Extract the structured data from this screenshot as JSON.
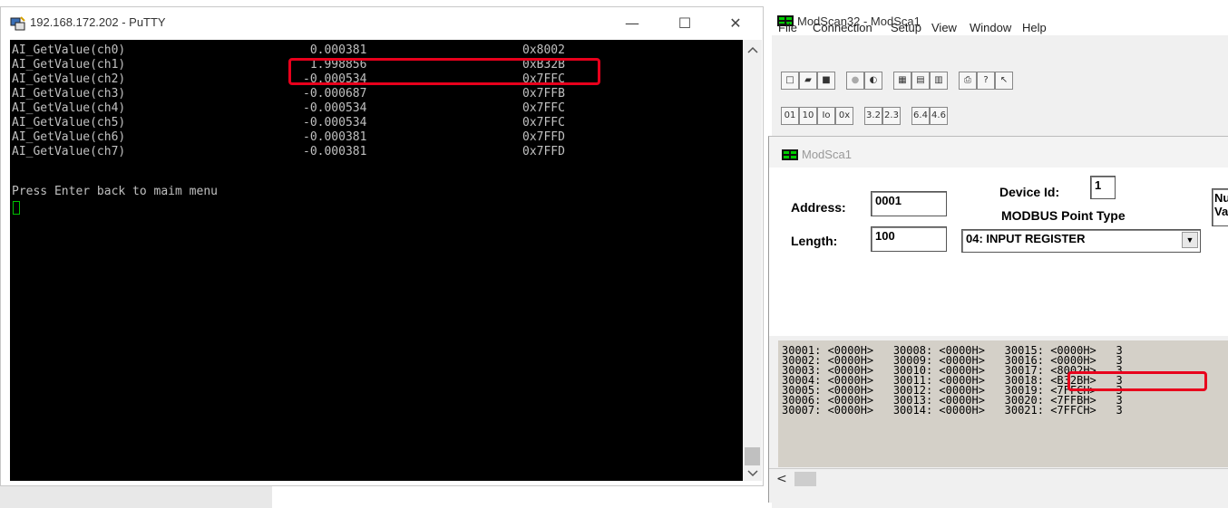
{
  "putty": {
    "title": "192.168.172.202 - PuTTY",
    "controls": {
      "minimize": "—",
      "maximize": "☐",
      "close": "✕"
    },
    "rows": [
      {
        "name": "AI_GetValue(ch0)",
        "value": " 0.000381",
        "hex": "0x8002"
      },
      {
        "name": "AI_GetValue(ch1)",
        "value": " 1.998856",
        "hex": "0xB32B"
      },
      {
        "name": "AI_GetValue(ch2)",
        "value": "-0.000534",
        "hex": "0x7FFC"
      },
      {
        "name": "AI_GetValue(ch3)",
        "value": "-0.000687",
        "hex": "0x7FFB"
      },
      {
        "name": "AI_GetValue(ch4)",
        "value": "-0.000534",
        "hex": "0x7FFC"
      },
      {
        "name": "AI_GetValue(ch5)",
        "value": "-0.000534",
        "hex": "0x7FFC"
      },
      {
        "name": "AI_GetValue(ch6)",
        "value": "-0.000381",
        "hex": "0x7FFD"
      },
      {
        "name": "AI_GetValue(ch7)",
        "value": "-0.000381",
        "hex": "0x7FFD"
      }
    ],
    "prompt": "Press Enter back to maim menu"
  },
  "modscan": {
    "title": "ModScan32 - ModSca1",
    "menu": [
      "File",
      "Connection",
      "Setup",
      "View",
      "Window",
      "Help"
    ],
    "child_title": "ModSca1",
    "device_id_label": "Device Id:",
    "device_id": "1",
    "address_label": "Address:",
    "address": "0001",
    "point_type_label": "MODBUS Point Type",
    "length_label": "Length:",
    "length": "100",
    "point_type": "04: INPUT REGISTER",
    "clipped_labels": [
      "Nu",
      "Va"
    ],
    "registers": [
      "30001: <0000H>   30008: <0000H>   30015: <0000H>   3",
      "30002: <0000H>   30009: <0000H>   30016: <0000H>   3",
      "30003: <0000H>   30010: <0000H>   30017: <8002H>   3",
      "30004: <0000H>   30011: <0000H>   30018: <B32BH>   3",
      "30005: <0000H>   30012: <0000H>   30019: <7FFCH>   3",
      "30006: <0000H>   30013: <0000H>   30020: <7FFBH>   3",
      "30007: <0000H>   30014: <0000H>   30021: <7FFCH>   3"
    ],
    "scroll_left": "<"
  }
}
